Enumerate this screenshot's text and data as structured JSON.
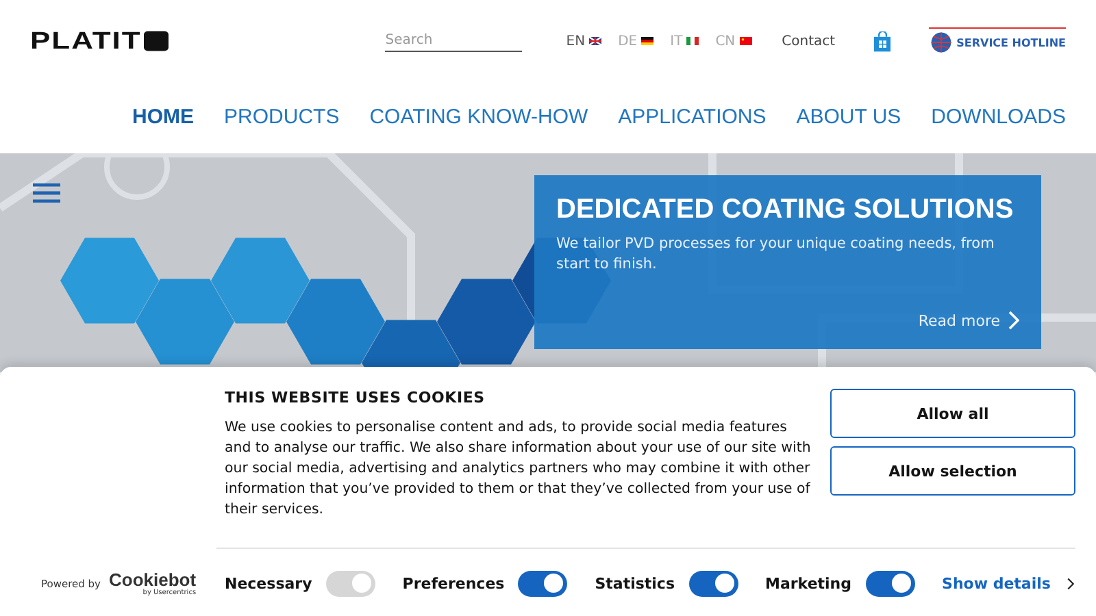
{
  "header": {
    "logo": "PLATIT",
    "search": {
      "placeholder": "Search"
    },
    "languages": [
      {
        "code": "EN",
        "kind": "uk",
        "selected": true
      },
      {
        "code": "DE",
        "kind": "de",
        "selected": false
      },
      {
        "code": "IT",
        "kind": "it",
        "selected": false
      },
      {
        "code": "CN",
        "kind": "cn",
        "selected": false
      }
    ],
    "contact": "Contact",
    "hotline": "SERVICE HOTLINE"
  },
  "nav": [
    {
      "label": "HOME",
      "selected": true
    },
    {
      "label": "PRODUCTS",
      "selected": false
    },
    {
      "label": "COATING KNOW-HOW",
      "selected": false
    },
    {
      "label": "APPLICATIONS",
      "selected": false
    },
    {
      "label": "ABOUT US",
      "selected": false
    },
    {
      "label": "DOWNLOADS",
      "selected": false
    }
  ],
  "hero": {
    "kind": "picture",
    "title": "DEDICATED COATING SOLUTIONS",
    "text": "We tailor PVD processes for your unique coating needs, from start to finish.",
    "link": "Read more"
  },
  "cookie_banner": {
    "title": "THIS WEBSITE USES COOKIES",
    "text": "We use cookies to personalise content and ads, to provide social media features and to analyse our traffic. We also share information about your use of our site with our social media, advertising and analytics partners who may combine it with other information that you’ve provided to them or that they’ve collected from your use of their services.",
    "buttons": [
      "Allow all",
      "Allow selection"
    ],
    "powered_by": "Powered by",
    "brand": "Cookiebot",
    "brand_sub": "by Usercentrics",
    "toggles": [
      {
        "label": "Necessary",
        "on": true,
        "disabled": true
      },
      {
        "label": "Preferences",
        "on": true,
        "disabled": false
      },
      {
        "label": "Statistics",
        "on": true,
        "disabled": false
      },
      {
        "label": "Marketing",
        "on": true,
        "disabled": false
      }
    ],
    "details": "Show details"
  }
}
